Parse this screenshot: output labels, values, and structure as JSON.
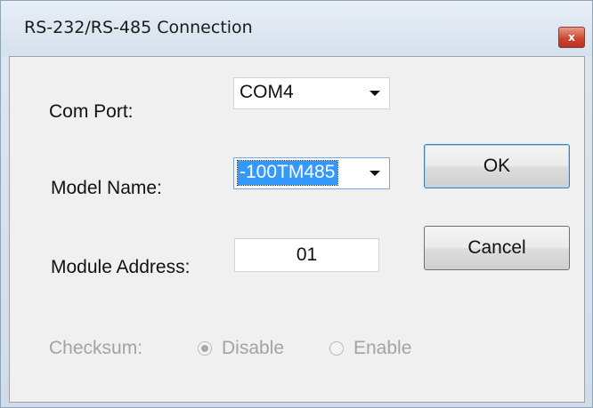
{
  "window": {
    "title": "RS-232/RS-485 Connection",
    "close_glyph": "x"
  },
  "form": {
    "com_port": {
      "label": "Com Port:",
      "value": "COM4"
    },
    "model_name": {
      "label": "Model Name:",
      "value": "-100TM485"
    },
    "module_address": {
      "label": "Module Address:",
      "value": "01"
    },
    "checksum": {
      "label": "Checksum:",
      "options": [
        {
          "label": "Disable",
          "selected": true
        },
        {
          "label": "Enable",
          "selected": false
        }
      ],
      "enabled": false
    }
  },
  "buttons": {
    "ok_label": "OK",
    "cancel_label": "Cancel"
  },
  "icons": {
    "close": "close-icon",
    "dropdown": "chevron-down-icon"
  }
}
